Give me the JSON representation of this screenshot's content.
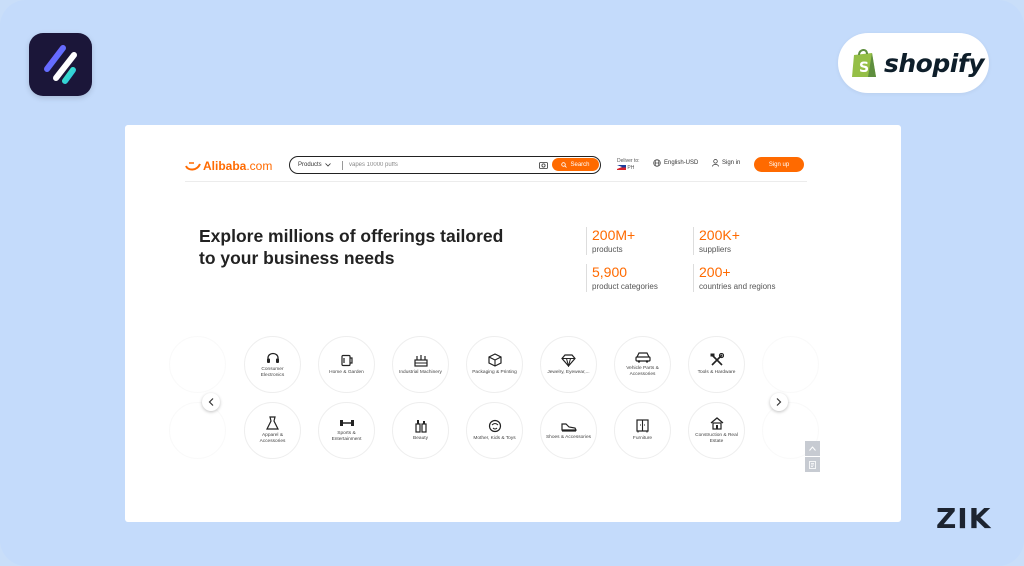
{
  "brand": {
    "shopify_text": "shopify",
    "zik_text": "ZIK",
    "accent": "#ff6a00"
  },
  "alibaba": {
    "logo_text": "Alibaba",
    "logo_suffix": ".com",
    "search": {
      "category": "Products",
      "value": "vapes 10000 puffs",
      "button": "Search"
    },
    "deliver_to": "Deliver to:",
    "deliver_country": "PH",
    "language": "English-USD",
    "sign_in": "Sign in",
    "sign_up": "Sign up"
  },
  "hero": {
    "headline_line1": "Explore millions of offerings tailored",
    "headline_line2": "to your business needs"
  },
  "stats": [
    {
      "value": "200M+",
      "label": "products"
    },
    {
      "value": "200K+",
      "label": "suppliers"
    },
    {
      "value": "5,900",
      "label": "product categories"
    },
    {
      "value": "200+",
      "label": "countries and regions"
    }
  ],
  "categories_row1": [
    {
      "label": "Consumer Electronics",
      "icon": "headphones-icon"
    },
    {
      "label": "Home & Garden",
      "icon": "home-garden-icon"
    },
    {
      "label": "Industrial Machinery",
      "icon": "machinery-icon"
    },
    {
      "label": "Packaging & Printing",
      "icon": "box-icon"
    },
    {
      "label": "Jewelry, Eyewear,...",
      "icon": "diamond-icon"
    },
    {
      "label": "Vehicle Parts & Accessories",
      "icon": "car-icon"
    },
    {
      "label": "Tools & Hardware",
      "icon": "tools-icon"
    }
  ],
  "categories_row2": [
    {
      "label": "Apparel & Accessories",
      "icon": "dress-icon"
    },
    {
      "label": "Sports & Entertainment",
      "icon": "dumbbell-icon"
    },
    {
      "label": "Beauty",
      "icon": "beauty-icon"
    },
    {
      "label": "Mother, Kids & Toys",
      "icon": "toy-icon"
    },
    {
      "label": "Shoes & Accessories",
      "icon": "shoe-icon"
    },
    {
      "label": "Furniture",
      "icon": "furniture-icon"
    },
    {
      "label": "Construction & Real Estate",
      "icon": "house-icon"
    }
  ]
}
